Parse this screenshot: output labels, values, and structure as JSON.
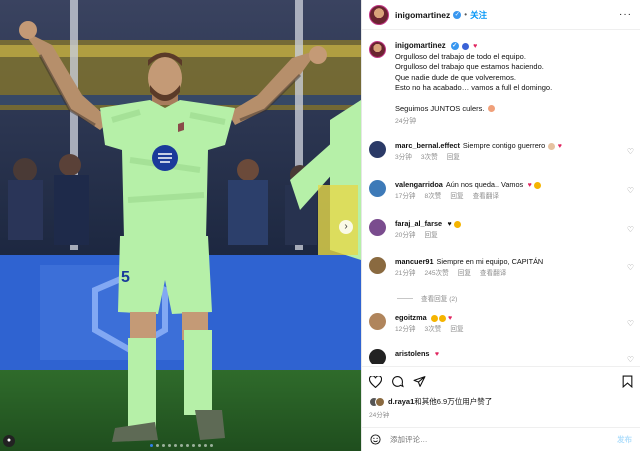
{
  "post": {
    "username": "inigomartinez",
    "follow_label": "关注",
    "more_label": "···",
    "verified_mark": "✓",
    "image_next_label": "›",
    "photo_user_icon": "person-icon",
    "carousel_dots": 11,
    "carousel_active": 0
  },
  "caption": {
    "username": "inigomartinez",
    "lines": [
      "Orgulloso del trabajo de todo el equipo.",
      "Orgulloso del trabajo que estamos haciendo.",
      "Que nadie dude de que volveremos.",
      "Esto no ha acabado… vamos a full el domingo.",
      "",
      "Seguimos JUNTOS culers."
    ],
    "time": "24分钟"
  },
  "comments": [
    {
      "username": "marc_bernal.effect",
      "text": "Siempre contigo guerrero",
      "time": "3分钟",
      "likes": "3次赞",
      "reply": "回复",
      "avatar_color": "#2b3a67"
    },
    {
      "username": "valengarridoa",
      "text": "Aún nos queda.. Vamos",
      "time": "17分钟",
      "likes": "8次赞",
      "reply": "回复",
      "translate": "查看翻译",
      "avatar_color": "#3d7ab8"
    },
    {
      "username": "faraj_al_farse",
      "text": "",
      "time": "20分钟",
      "reply": "回复",
      "avatar_color": "#7a4c8e"
    },
    {
      "username": "mancuer91",
      "text": "Siempre en mi equipo, CAPITÁN",
      "time": "21分钟",
      "likes": "245次赞",
      "reply": "回复",
      "translate": "查看翻译",
      "avatar_color": "#8a6a40"
    },
    {
      "username": "egoitzma",
      "text": "",
      "time": "12分钟",
      "likes": "3次赞",
      "reply": "回复",
      "avatar_color": "#b0855c"
    },
    {
      "username": "aristolens",
      "text": "",
      "avatar_color": "#222222"
    }
  ],
  "view_replies": "查看回复 (2)",
  "likes": {
    "name": "d.raya1",
    "rest": "和其他6.9万位用户赞了"
  },
  "post_time": "24分钟",
  "add_comment": {
    "placeholder": "添加评论…",
    "send": "发布"
  },
  "colors": {
    "accent": "#0095f6",
    "jersey": "#b6f0a8",
    "heart": "#e0245e",
    "verified": "#3897f0"
  }
}
